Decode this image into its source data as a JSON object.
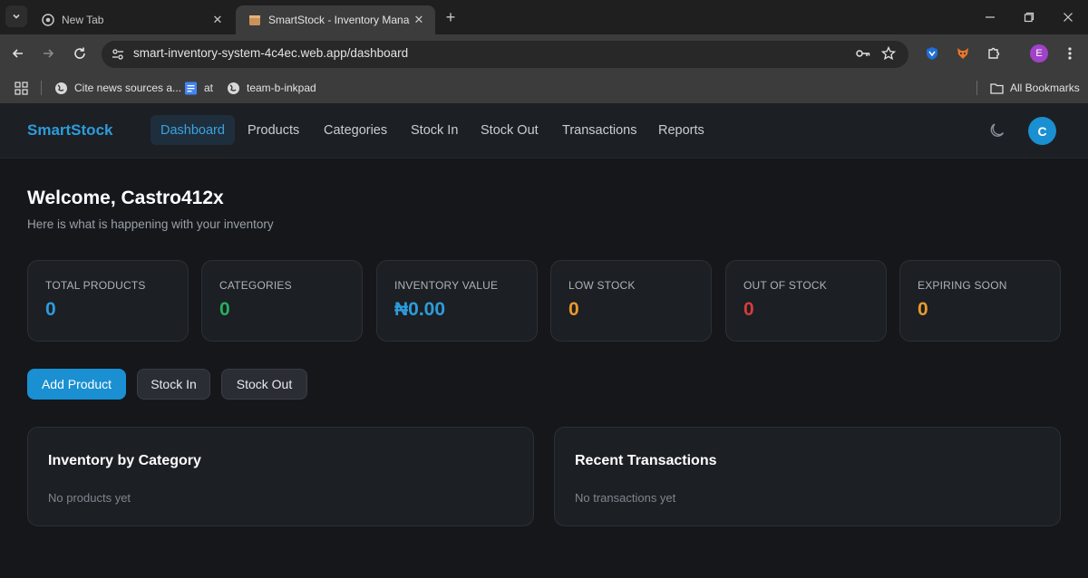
{
  "browser": {
    "tabs": [
      {
        "title": "New Tab",
        "active": false
      },
      {
        "title": "SmartStock - Inventory Manage",
        "active": true
      }
    ],
    "url": "smart-inventory-system-4c4ec.web.app/dashboard",
    "bookmarks": [
      {
        "label": "Cite news sources a..."
      },
      {
        "label": "at"
      },
      {
        "label": "team-b-inkpad"
      }
    ],
    "all_bookmarks": "All Bookmarks",
    "profile_initial": "E"
  },
  "app": {
    "brand": "SmartStock",
    "nav": [
      "Dashboard",
      "Products",
      "Categories",
      "Stock In",
      "Stock Out",
      "Transactions",
      "Reports"
    ],
    "active_nav": "Dashboard",
    "avatar_initial": "C",
    "accent_color": "#1a8fd1"
  },
  "welcome": {
    "title": "Welcome, Castro412x",
    "subtitle": "Here is what is happening with your inventory"
  },
  "stats": [
    {
      "label": "TOTAL PRODUCTS",
      "value": "0",
      "color": "#2d9cdb"
    },
    {
      "label": "CATEGORIES",
      "value": "0",
      "color": "#27ae60"
    },
    {
      "label": "INVENTORY VALUE",
      "value": "₦0.00",
      "color": "#2d9cdb"
    },
    {
      "label": "LOW STOCK",
      "value": "0",
      "color": "#e89a2c"
    },
    {
      "label": "OUT OF STOCK",
      "value": "0",
      "color": "#d63c3c"
    },
    {
      "label": "EXPIRING SOON",
      "value": "0",
      "color": "#e89a2c"
    }
  ],
  "actions": [
    "Add Product",
    "Stock In",
    "Stock Out"
  ],
  "panels": [
    {
      "title": "Inventory by Category",
      "empty": "No products yet"
    },
    {
      "title": "Recent Transactions",
      "empty": "No transactions yet"
    }
  ]
}
